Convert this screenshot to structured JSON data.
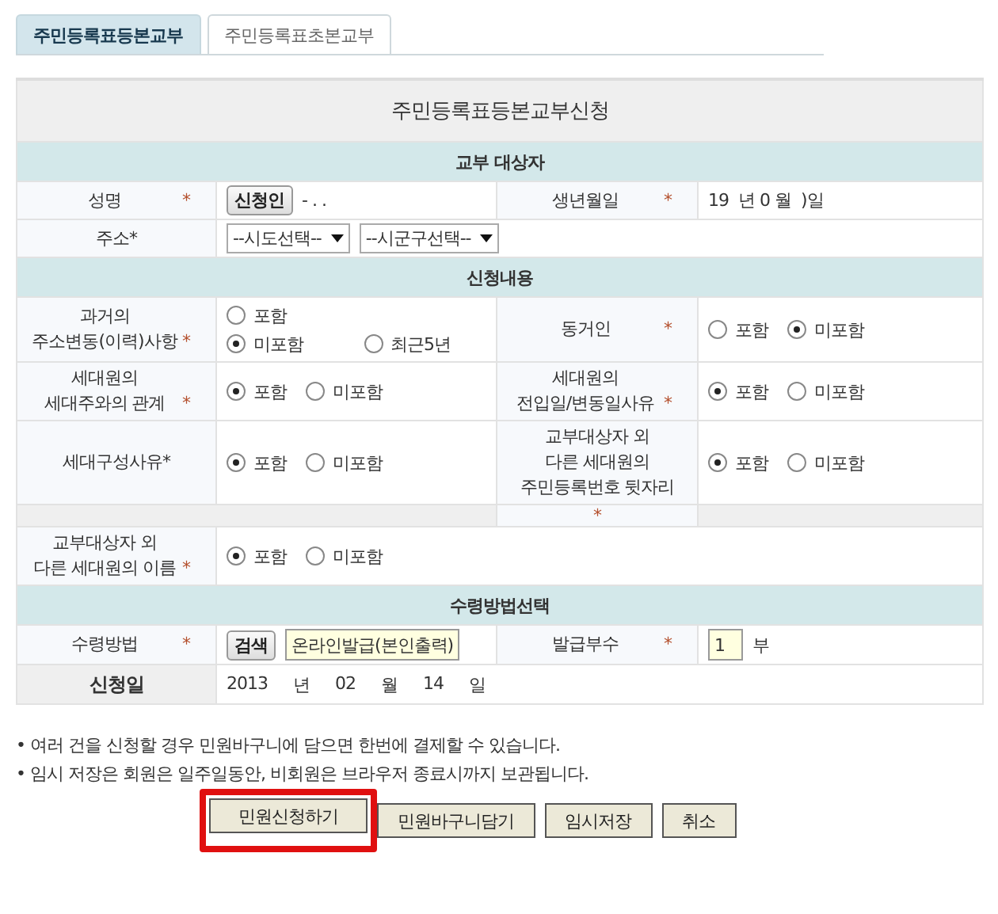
{
  "tabs": [
    {
      "label": "주민등록표등본교부",
      "selected": true
    },
    {
      "label": "주민등록표초본교부",
      "selected": false
    }
  ],
  "form": {
    "title": "주민등록표등본교부신청",
    "rows": [
      {
        "kind": "section",
        "title": "교부 대상자"
      },
      {
        "kind": "fields",
        "fields": [
          {
            "label": "성명",
            "asterisk": "*",
            "value": {
              "kind": "applicant",
              "button": "신청인",
              "text": "- . ."
            }
          },
          {
            "label": "생년월일",
            "asterisk": "*",
            "value": {
              "kind": "text",
              "text": "19  년 0 월  )일"
            }
          }
        ]
      },
      {
        "kind": "fields",
        "fields": [
          {
            "label": "주소*",
            "value": {
              "kind": "selects",
              "selects": [
                "--시도선택--",
                "--시군구선택--"
              ]
            }
          }
        ]
      },
      {
        "kind": "section",
        "title": "신청내용"
      },
      {
        "kind": "fields",
        "fields": [
          {
            "label": "과거의\n주소변동(이력)사항",
            "asterisk": "*",
            "value": {
              "kind": "radios",
              "lines": [
                [
                  {
                    "label": "포함",
                    "selected": false
                  }
                ],
                [
                  {
                    "label": "미포함",
                    "selected": true
                  },
                  {
                    "label": "최근5년",
                    "selected": false
                  }
                ]
              ]
            }
          },
          {
            "label": "동거인",
            "asterisk": "*",
            "value": {
              "kind": "radios",
              "lines": [
                [
                  {
                    "label": "포함",
                    "selected": false
                  },
                  {
                    "label": "미포함",
                    "selected": true
                  }
                ]
              ]
            }
          }
        ]
      },
      {
        "kind": "fields",
        "fields": [
          {
            "label": "세대원의\n세대주와의 관계",
            "asterisk": "*",
            "value": {
              "kind": "radios",
              "lines": [
                [
                  {
                    "label": "포함",
                    "selected": true
                  },
                  {
                    "label": "미포함",
                    "selected": false
                  }
                ]
              ]
            }
          },
          {
            "label": "세대원의\n전입일/변동일사유",
            "asterisk": "*",
            "value": {
              "kind": "radios",
              "lines": [
                [
                  {
                    "label": "포함",
                    "selected": true
                  },
                  {
                    "label": "미포함",
                    "selected": false
                  }
                ]
              ]
            }
          }
        ]
      },
      {
        "kind": "fields",
        "fields": [
          {
            "label": "세대구성사유*",
            "value": {
              "kind": "radios",
              "lines": [
                [
                  {
                    "label": "포함",
                    "selected": true
                  },
                  {
                    "label": "미포함",
                    "selected": false
                  }
                ]
              ]
            }
          },
          {
            "label": "교부대상자 외\n다른 세대원의\n주민등록번호 뒷자리",
            "value": {
              "kind": "radios",
              "lines": [
                [
                  {
                    "label": "포함",
                    "selected": true
                  },
                  {
                    "label": "미포함",
                    "selected": false
                  }
                ]
              ]
            }
          }
        ]
      },
      {
        "kind": "spacer",
        "asterisk": "*"
      },
      {
        "kind": "fields",
        "fields": [
          {
            "label": "교부대상자 외\n다른 세대원의 이름",
            "asterisk": "*",
            "value": {
              "kind": "radios",
              "lines": [
                [
                  {
                    "label": "포함",
                    "selected": true
                  },
                  {
                    "label": "미포함",
                    "selected": false
                  }
                ]
              ]
            }
          }
        ]
      },
      {
        "kind": "section",
        "title": "수령방법선택"
      },
      {
        "kind": "fields",
        "fields": [
          {
            "label": "수령방법",
            "asterisk": "*",
            "value": {
              "kind": "method",
              "button": "검색",
              "text": "온라인발급(본인출력)"
            }
          },
          {
            "label": "발급부수",
            "asterisk": "*",
            "value": {
              "kind": "count",
              "text": "1",
              "unit": "부"
            }
          }
        ]
      },
      {
        "kind": "date",
        "label": "신청일",
        "parts": [
          "2013",
          "년",
          "02",
          "월",
          "14",
          "일"
        ]
      }
    ]
  },
  "notes": [
    "• 여러 건을 신청할 경우 민원바구니에 담으면 한번에 결제할 수 있습니다.",
    "• 임시 저장은 회원은 일주일동안, 비회원은 브라우저 종료시까지 보관됩니다."
  ],
  "buttons": [
    {
      "label": "민원신청하기",
      "highlighted": true
    },
    {
      "label": "민원바구니담기",
      "highlighted": false
    },
    {
      "label": "임시저장",
      "highlighted": false
    },
    {
      "label": "취소",
      "highlighted": false
    }
  ]
}
